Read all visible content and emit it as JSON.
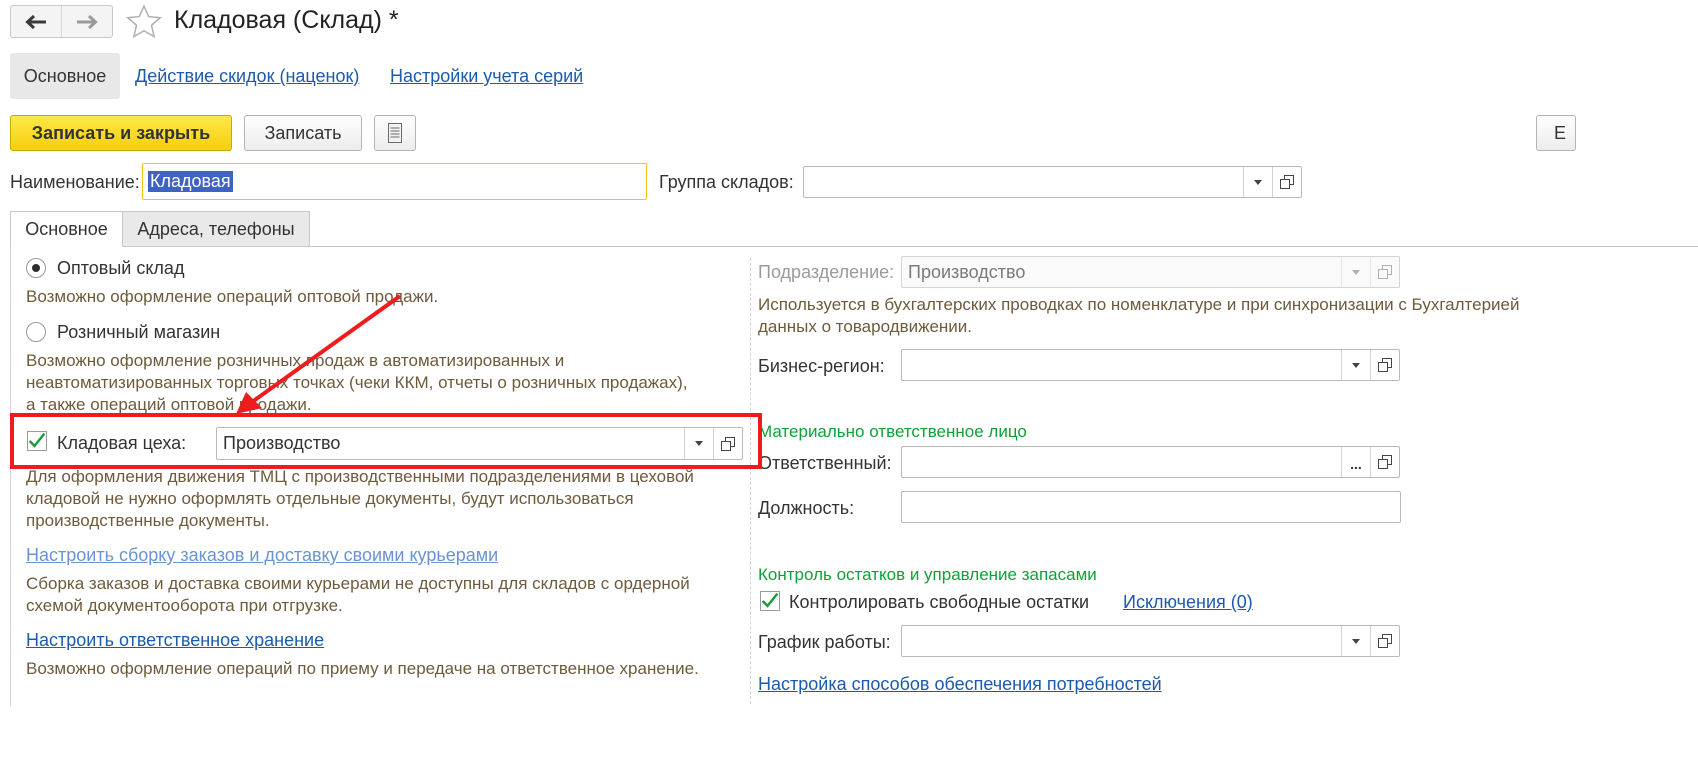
{
  "window": {
    "title": "Кладовая (Склад) *",
    "back_icon": "arrow-left-icon",
    "forward_icon": "arrow-right-icon",
    "favorite_icon": "star-icon"
  },
  "sections": {
    "active": "Основное",
    "links": [
      "Действие скидок (наценок)",
      "Настройки учета серий"
    ]
  },
  "toolbar": {
    "save_close_label": "Записать и закрыть",
    "save_label": "Записать",
    "menu_icon": "list-icon",
    "right_button_label": "Е"
  },
  "header": {
    "name_label": "Наименование:",
    "name_value": "Кладовая",
    "group_label": "Группа складов:",
    "group_value": ""
  },
  "tabs": [
    "Основное",
    "Адреса, телефоны"
  ],
  "left": {
    "wholesale": {
      "label": "Оптовый склад",
      "selected": true,
      "desc": "Возможно оформление операций оптовой продажи."
    },
    "retail": {
      "label": "Розничный магазин",
      "selected": false,
      "desc_1": "Возможно оформление розничных продаж в автоматизированных и",
      "desc_2": "неавтоматизированных торговых точках (чеки ККМ, отчеты о розничных продажах),",
      "desc_3": "а также операций оптовой продажи."
    },
    "workshop": {
      "label": "Кладовая цеха:",
      "checked": true,
      "value": "Производство",
      "desc_1": "Для оформления движения ТМЦ с производственными подразделениями в цеховой",
      "desc_2": "кладовой не нужно оформлять отдельные документы, будут использоваться",
      "desc_3": "производственные документы."
    },
    "delivery": {
      "link": "Настроить сборку заказов и доставку своими курьерами",
      "desc_1": "Сборка заказов и доставка своими курьерами не доступны для складов с ордерной",
      "desc_2": "схемой документооборота при отгрузке."
    },
    "custody": {
      "link": "Настроить ответственное хранение",
      "desc": "Возможно оформление операций по приему и передаче на ответственное хранение."
    }
  },
  "right": {
    "department": {
      "label": "Подразделение:",
      "value": "Производство",
      "desc_1": "Используется в бухгалтерских проводках по номенклатуре и при синхронизации с Бухгалтерией",
      "desc_2": "данных о товародвижении."
    },
    "business_region": {
      "label": "Бизнес-регион:",
      "value": ""
    },
    "responsible_section": "Материально ответственное лицо",
    "responsible": {
      "label": "Ответственный:",
      "value": ""
    },
    "position": {
      "label": "Должность:",
      "value": ""
    },
    "stock_section": "Контроль остатков и управление запасами",
    "control_free_stock": {
      "label": "Контролировать свободные остатки",
      "checked": true
    },
    "exceptions_link": "Исключения (0)",
    "schedule": {
      "label": "График работы:",
      "value": ""
    },
    "supply_link": "Настройка способов обеспечения потребностей"
  },
  "colors": {
    "accent_yellow": "#f6cf0a",
    "link_blue": "#1a5ab0",
    "section_green": "#10a038",
    "annotation_red": "#ee1c1c",
    "selection_blue": "#3f63c4"
  }
}
